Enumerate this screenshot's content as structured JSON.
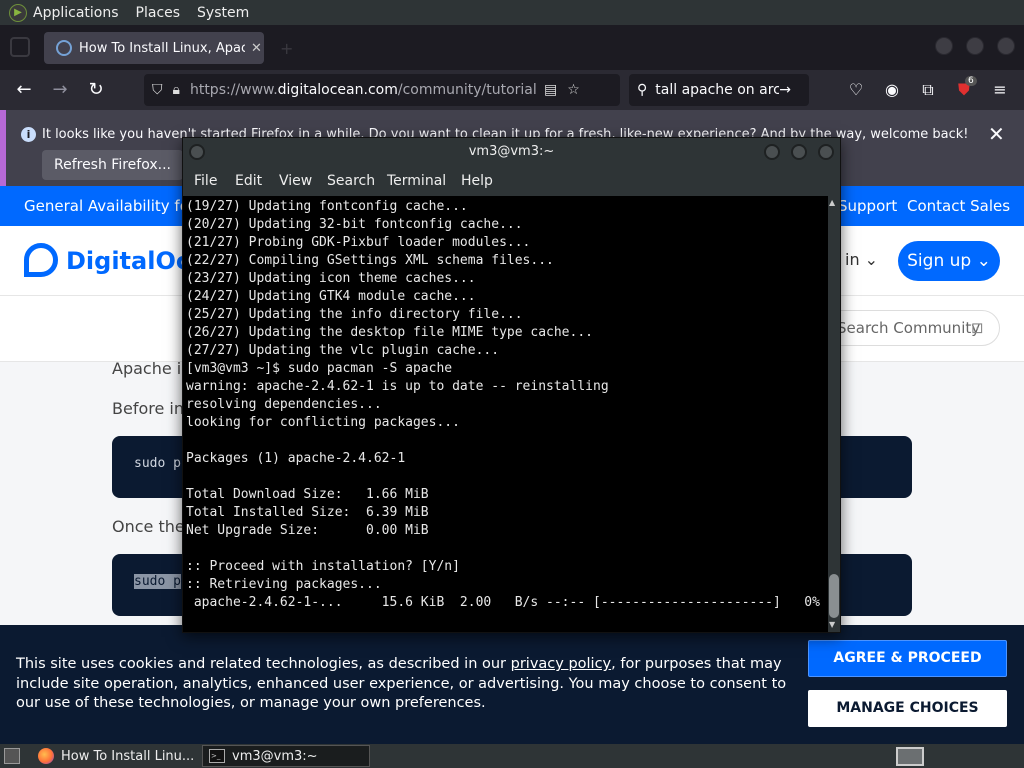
{
  "gnome_panel": {
    "menus": [
      "Applications",
      "Places",
      "System"
    ]
  },
  "firefox": {
    "tab_title": "How To Install Linux, Apach",
    "url_prefix": "https://www.",
    "url_domain": "digitalocean.com",
    "url_rest": "/community/tutorials/how",
    "search_text": "tall apache on arch",
    "extension_badge": "6",
    "notification_text": "It looks like you haven't started Firefox in a while. Do you want to clean it up for a fresh, like-new experience? And by the way, welcome back!",
    "refresh_button": "Refresh Firefox..."
  },
  "page": {
    "banner_left": "General Availability for V",
    "banner_support": "Support",
    "banner_contact": "Contact Sales",
    "logo_text": "DigitalOce",
    "login_text": "in ⌄",
    "signup_text": "Sign up ⌄",
    "search_community": "Search Community",
    "para1": "Apache is",
    "para2": "Before ins",
    "code1": "sudo p",
    "para3": "Once the",
    "code2": "sudo p"
  },
  "cookie": {
    "text_before": "This site uses cookies and related technologies, as described in our ",
    "link": "privacy policy",
    "text_after": ", for purposes that may include site operation, analytics, enhanced user experience, or advertising. You may choose to consent to our use of these technologies, or manage your own preferences.",
    "agree": "AGREE & PROCEED",
    "manage": "MANAGE CHOICES"
  },
  "terminal": {
    "title": "vm3@vm3:~",
    "menu": [
      "File",
      "Edit",
      "View",
      "Search",
      "Terminal",
      "Help"
    ],
    "lines": [
      "(19/27) Updating fontconfig cache...",
      "(20/27) Updating 32-bit fontconfig cache...",
      "(21/27) Probing GDK-Pixbuf loader modules...",
      "(22/27) Compiling GSettings XML schema files...",
      "(23/27) Updating icon theme caches...",
      "(24/27) Updating GTK4 module cache...",
      "(25/27) Updating the info directory file...",
      "(26/27) Updating the desktop file MIME type cache...",
      "(27/27) Updating the vlc plugin cache...",
      "[vm3@vm3 ~]$ sudo pacman -S apache",
      "warning: apache-2.4.62-1 is up to date -- reinstalling",
      "resolving dependencies...",
      "looking for conflicting packages...",
      "",
      "Packages (1) apache-2.4.62-1",
      "",
      "Total Download Size:   1.66 MiB",
      "Total Installed Size:  6.39 MiB",
      "Net Upgrade Size:      0.00 MiB",
      "",
      ":: Proceed with installation? [Y/n]",
      ":: Retrieving packages...",
      " apache-2.4.62-1-...     15.6 KiB  2.00   B/s --:-- [----------------------]   0%"
    ]
  },
  "taskbar": {
    "item1": "How To Install Linu...",
    "item2": "vm3@vm3:~"
  }
}
